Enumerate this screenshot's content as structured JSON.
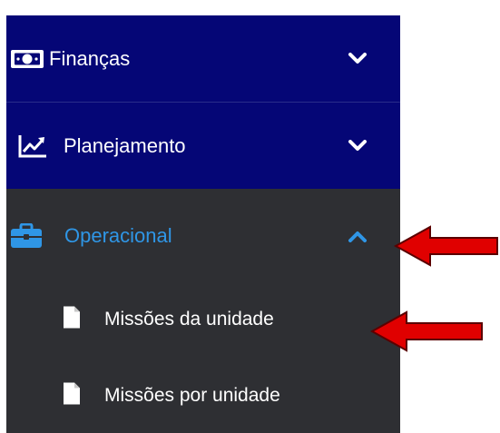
{
  "menu": {
    "financas": {
      "label": "Finanças",
      "icon": "money-bill-icon",
      "chevron": "chevron-down-icon"
    },
    "planejamento": {
      "label": "Planejamento",
      "icon": "chart-line-icon",
      "chevron": "chevron-down-icon"
    },
    "operacional": {
      "label": "Operacional",
      "icon": "briefcase-icon",
      "chevron": "chevron-up-icon",
      "children": [
        {
          "label": "Missões da unidade",
          "icon": "file-icon"
        },
        {
          "label": "Missões por unidade",
          "icon": "file-icon"
        }
      ]
    }
  },
  "colors": {
    "navy": "#050676",
    "dark_panel": "#2e2f33",
    "active_blue": "#2f96e6",
    "annotation_arrow": "#e00000"
  }
}
